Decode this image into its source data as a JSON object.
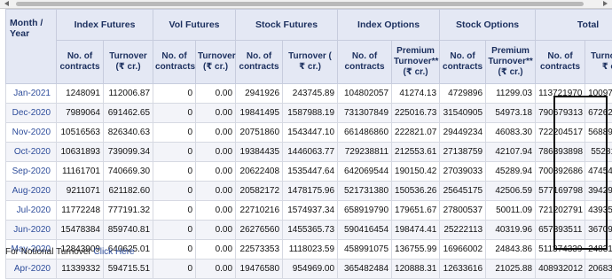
{
  "headers": {
    "month_year": "Month / Year",
    "groups": [
      "Index Futures",
      "Vol Futures",
      "Stock Futures",
      "Index Options",
      "Stock Options",
      "Total"
    ],
    "sub": [
      "No. of contracts",
      "Turnover (₹ cr.)",
      "No. of contracts",
      "Turnover (₹ cr.)",
      "No. of contracts",
      "Turnover ( ₹ cr.)",
      "No. of contracts",
      "Premium Turnover** (₹ cr.)",
      "No. of contracts",
      "Premium Turnover** (₹ cr.)",
      "No. of contracts",
      "Turnover*( ₹ cr.)"
    ]
  },
  "rows": [
    {
      "month": "Jan-2021",
      "cells": [
        "1248091",
        "112006.87",
        "0",
        "0.00",
        "2941926",
        "243745.89",
        "104802057",
        "41274.13",
        "4729896",
        "11299.03",
        "113721970",
        "10097185.15"
      ]
    },
    {
      "month": "Dec-2020",
      "cells": [
        "7989064",
        "691462.65",
        "0",
        "0.00",
        "19841495",
        "1587988.19",
        "731307849",
        "225016.73",
        "31540905",
        "54973.18",
        "790679313",
        "67262247.98"
      ]
    },
    {
      "month": "Nov-2020",
      "cells": [
        "10516563",
        "826340.63",
        "0",
        "0.00",
        "20751860",
        "1543447.10",
        "661486860",
        "222821.07",
        "29449234",
        "46083.30",
        "722204517",
        "56889565.39"
      ]
    },
    {
      "month": "Oct-2020",
      "cells": [
        "10631893",
        "739099.34",
        "0",
        "0.00",
        "19384435",
        "1446063.77",
        "729238811",
        "212553.61",
        "27138759",
        "42107.94",
        "786393898",
        "55281624.3"
      ]
    },
    {
      "month": "Sep-2020",
      "cells": [
        "11161701",
        "740669.30",
        "0",
        "0.00",
        "20622408",
        "1535447.64",
        "642069544",
        "190150.42",
        "27039033",
        "45289.94",
        "700892686",
        "47454518.43"
      ]
    },
    {
      "month": "Aug-2020",
      "cells": [
        "9211071",
        "621182.60",
        "0",
        "0.00",
        "20582172",
        "1478175.96",
        "521731380",
        "150536.26",
        "25645175",
        "42506.59",
        "577169798",
        "39429369.52"
      ]
    },
    {
      "month": "Jul-2020",
      "cells": [
        "11772248",
        "777191.32",
        "0",
        "0.00",
        "22710216",
        "1574937.34",
        "658919790",
        "179651.67",
        "27800537",
        "50011.09",
        "721202791",
        "43935708.47"
      ]
    },
    {
      "month": "Jun-2020",
      "cells": [
        "15478384",
        "859740.81",
        "0",
        "0.00",
        "26276560",
        "1455365.73",
        "590416454",
        "198474.41",
        "25222113",
        "40319.96",
        "657393511",
        "36709780.38"
      ]
    },
    {
      "month": "May-2020",
      "cells": [
        "12843909",
        "640625.01",
        "0",
        "0.00",
        "22573353",
        "1118023.59",
        "458991075",
        "136755.99",
        "16966002",
        "24843.86",
        "511374339",
        "24831931.01"
      ]
    },
    {
      "month": "Apr-2020",
      "cells": [
        "11339332",
        "594715.51",
        "0",
        "0.00",
        "19476580",
        "954969.00",
        "365482484",
        "120888.31",
        "12633616",
        "21025.88",
        "408932012",
        "20683378.42"
      ]
    }
  ],
  "footnote": {
    "text": "For Notional Turnover",
    "link": "Click Here"
  }
}
